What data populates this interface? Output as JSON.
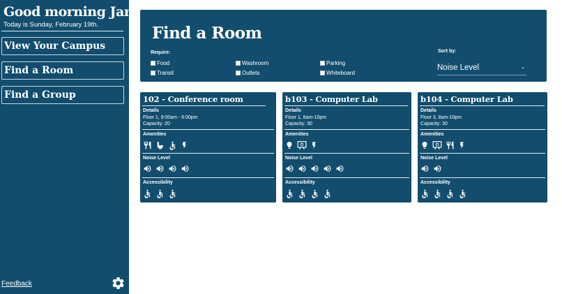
{
  "sidebar": {
    "greeting": "Good morning Jane.",
    "date_line": "Today is Sunday, February 19th.",
    "nav": [
      {
        "label": "View Your Campus"
      },
      {
        "label": "Find a Room"
      },
      {
        "label": "Find a Group"
      }
    ],
    "feedback_label": "Feedback",
    "settings_icon": "gear-icon"
  },
  "main": {
    "title": "Find a Room",
    "require_label": "Require:",
    "filters": [
      {
        "label": "Food",
        "checked": false
      },
      {
        "label": "Washroom",
        "checked": false
      },
      {
        "label": "Parking",
        "checked": false
      },
      {
        "label": "Transit",
        "checked": false
      },
      {
        "label": "Outlets",
        "checked": false
      },
      {
        "label": "Whiteboard",
        "checked": false
      }
    ],
    "sort_label": "Sort by:",
    "sort_value": "Noise Level"
  },
  "cards": [
    {
      "title": "102 - Conference room",
      "details_label": "Details",
      "detail_lines": [
        "Floor 1, 9:00am - 6:00pm",
        "Capacity: 20"
      ],
      "amenities_label": "Amenities",
      "amenities": [
        "food-icon",
        "washroom-icon",
        "accessible-icon",
        "outlet-icon"
      ],
      "noise_label": "Noise Level",
      "noise_level": 4,
      "accessibility_label": "Accessibility",
      "accessibility_level": 3
    },
    {
      "title": "b103 - Computer Lab",
      "details_label": "Details",
      "detail_lines": [
        "Floor 1, 8am-10pm",
        "Capacity: 30"
      ],
      "amenities_label": "Amenities",
      "amenities": [
        "lightbulb-icon",
        "whiteboard-icon",
        "outlet-icon"
      ],
      "noise_label": "Noise Level",
      "noise_level": 5,
      "accessibility_label": "Accessibility",
      "accessibility_level": 4
    },
    {
      "title": "b104 - Computer Lab",
      "details_label": "Details",
      "detail_lines": [
        "Floor 3, 8am-10pm",
        "Capacity: 30"
      ],
      "amenities_label": "Amenities",
      "amenities": [
        "lightbulb-icon",
        "whiteboard-icon",
        "food-icon",
        "outlet-icon"
      ],
      "noise_label": "Noise Level",
      "noise_level": 2,
      "accessibility_label": "Accessibility",
      "accessibility_level": 4
    }
  ],
  "colors": {
    "panel": "#124d6e",
    "text": "#ffffff",
    "background": "#ffffff"
  }
}
